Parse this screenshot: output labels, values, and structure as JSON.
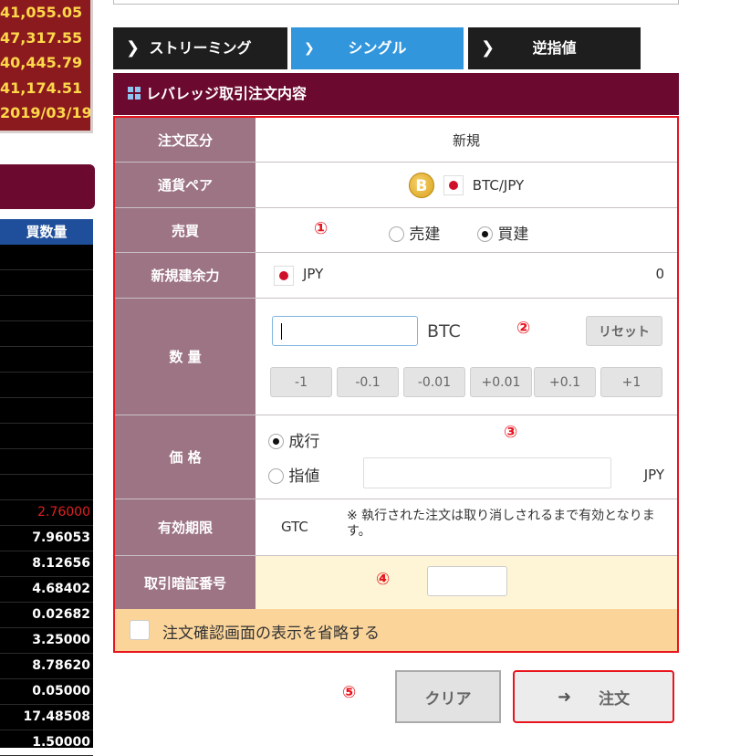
{
  "left_panel": {
    "prices": [
      "41,055.05",
      "47,317.55",
      "40,445.79",
      "41,174.51",
      "2019/03/19"
    ],
    "qty_header": "買数量",
    "qty_rows": [
      "",
      "",
      "",
      "",
      "",
      "",
      "",
      "",
      "",
      "",
      "2.76000",
      "7.96053",
      "8.12656",
      "4.68402",
      "0.02682",
      "3.25000",
      "8.78620",
      "0.05000",
      "17.48508",
      "1.50000"
    ],
    "highlight_color": "#e02020"
  },
  "mode_tabs": [
    {
      "label": "ストリーミング",
      "icon": "chevron-right-icon"
    },
    {
      "label": "シングル",
      "icon": "chevron-down-icon"
    },
    {
      "label": "逆指値",
      "icon": "chevron-right-icon"
    }
  ],
  "form": {
    "title": "レバレッジ取引注文内容",
    "order_type": {
      "label": "注文区分",
      "value": "新規"
    },
    "pair": {
      "label": "通貨ペア",
      "value": "BTC/JPY",
      "coin_glyph": "B"
    },
    "side": {
      "label": "売買",
      "marker": "①",
      "options": [
        "売建",
        "買建"
      ],
      "selected": "買建"
    },
    "margin": {
      "label": "新規建余力",
      "currency": "JPY",
      "value": "0"
    },
    "quantity": {
      "label": "数 量",
      "value": "",
      "unit": "BTC",
      "marker": "②",
      "reset_label": "リセット",
      "steps": [
        "-1",
        "-0.1",
        "-0.01",
        "+0.01",
        "+0.1",
        "+1"
      ]
    },
    "price": {
      "label": "価 格",
      "marker": "③",
      "options": [
        "成行",
        "指値"
      ],
      "selected": "成行",
      "limit_value": "",
      "unit": "JPY"
    },
    "expiry": {
      "label": "有効期限",
      "value": "GTC",
      "note": "※ 執行された注文は取り消しされるまで有効となります。"
    },
    "pin": {
      "label": "取引暗証番号",
      "marker": "④",
      "value": ""
    },
    "skip_confirm": {
      "label": "注文確認画面の表示を省略する",
      "checked": false
    }
  },
  "actions": {
    "marker": "⑤",
    "clear_label": "クリア",
    "order_label": "注文"
  },
  "colors": {
    "accent_red": "#e8141e",
    "header_maroon": "#6b0a2e",
    "label_mauve": "#9d7484",
    "active_tab_blue": "#3296dc"
  }
}
